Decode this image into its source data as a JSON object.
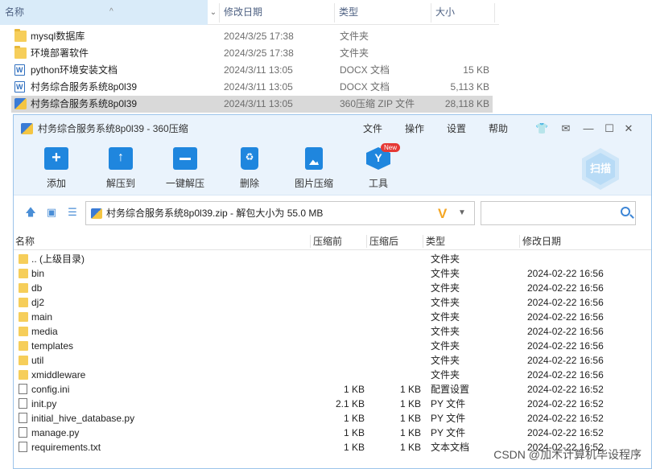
{
  "explorer": {
    "columns": {
      "name": "名称",
      "modified": "修改日期",
      "type": "类型",
      "size": "大小"
    },
    "sort_caret": "^",
    "header_chevron": "⌄",
    "rows": [
      {
        "name": "mysql数据库",
        "modified": "2024/3/25 17:38",
        "type": "文件夹",
        "size": "",
        "icon": "folder-icon"
      },
      {
        "name": "环境部署软件",
        "modified": "2024/3/25 17:38",
        "type": "文件夹",
        "size": "",
        "icon": "folder-icon"
      },
      {
        "name": "python环境安装文档",
        "modified": "2024/3/11 13:05",
        "type": "DOCX 文档",
        "size": "15 KB",
        "icon": "word-doc-icon"
      },
      {
        "name": "村务综合服务系统8p0l39",
        "modified": "2024/3/11 13:05",
        "type": "DOCX 文档",
        "size": "5,113 KB",
        "icon": "word-doc-icon"
      },
      {
        "name": "村务综合服务系统8p0l39",
        "modified": "2024/3/11 13:05",
        "type": "360压缩 ZIP 文件",
        "size": "28,118 KB",
        "icon": "zip-icon"
      }
    ]
  },
  "window": {
    "title": "村务综合服务系统8p0l39 - 360压缩",
    "menu": {
      "file": "文件",
      "operate": "操作",
      "settings": "设置",
      "help": "帮助"
    },
    "controls": {
      "skin": "👕",
      "feedback": "✉",
      "minimize": "—",
      "maximize": "☐",
      "close": "✕"
    },
    "toolbar": {
      "add": "添加",
      "extract_to": "解压到",
      "one_click_extract": "一键解压",
      "delete": "删除",
      "image_compress": "图片压缩",
      "tools": "工具",
      "new_badge": "New",
      "scan": "扫描"
    },
    "address": {
      "up_arrow": "🡅",
      "view_icon": "▣",
      "list_icon": "☰",
      "path": "村务综合服务系统8p0l39.zip - 解包大小为 55.0 MB",
      "v_logo": "V",
      "dropdown": "▼"
    },
    "list": {
      "columns": {
        "name": "名称",
        "before": "压缩前",
        "after": "压缩后",
        "type": "类型",
        "modified": "修改日期"
      },
      "rows": [
        {
          "name": ".. (上级目录)",
          "before": "",
          "after": "",
          "type": "文件夹",
          "modified": "",
          "kind": "folder"
        },
        {
          "name": "bin",
          "before": "",
          "after": "",
          "type": "文件夹",
          "modified": "2024-02-22 16:56",
          "kind": "folder"
        },
        {
          "name": "db",
          "before": "",
          "after": "",
          "type": "文件夹",
          "modified": "2024-02-22 16:56",
          "kind": "folder"
        },
        {
          "name": "dj2",
          "before": "",
          "after": "",
          "type": "文件夹",
          "modified": "2024-02-22 16:56",
          "kind": "folder"
        },
        {
          "name": "main",
          "before": "",
          "after": "",
          "type": "文件夹",
          "modified": "2024-02-22 16:56",
          "kind": "folder"
        },
        {
          "name": "media",
          "before": "",
          "after": "",
          "type": "文件夹",
          "modified": "2024-02-22 16:56",
          "kind": "folder"
        },
        {
          "name": "templates",
          "before": "",
          "after": "",
          "type": "文件夹",
          "modified": "2024-02-22 16:56",
          "kind": "folder"
        },
        {
          "name": "util",
          "before": "",
          "after": "",
          "type": "文件夹",
          "modified": "2024-02-22 16:56",
          "kind": "folder"
        },
        {
          "name": "xmiddleware",
          "before": "",
          "after": "",
          "type": "文件夹",
          "modified": "2024-02-22 16:56",
          "kind": "folder"
        },
        {
          "name": "config.ini",
          "before": "1 KB",
          "after": "1 KB",
          "type": "配置设置",
          "modified": "2024-02-22 16:52",
          "kind": "file"
        },
        {
          "name": "init.py",
          "before": "2.1 KB",
          "after": "1 KB",
          "type": "PY 文件",
          "modified": "2024-02-22 16:52",
          "kind": "file"
        },
        {
          "name": "initial_hive_database.py",
          "before": "1 KB",
          "after": "1 KB",
          "type": "PY 文件",
          "modified": "2024-02-22 16:52",
          "kind": "file"
        },
        {
          "name": "manage.py",
          "before": "1 KB",
          "after": "1 KB",
          "type": "PY 文件",
          "modified": "2024-02-22 16:52",
          "kind": "file"
        },
        {
          "name": "requirements.txt",
          "before": "1 KB",
          "after": "1 KB",
          "type": "文本文档",
          "modified": "2024-02-22 16:52",
          "kind": "file"
        }
      ]
    }
  },
  "watermark": "CSDN @加木计算机毕设程序"
}
